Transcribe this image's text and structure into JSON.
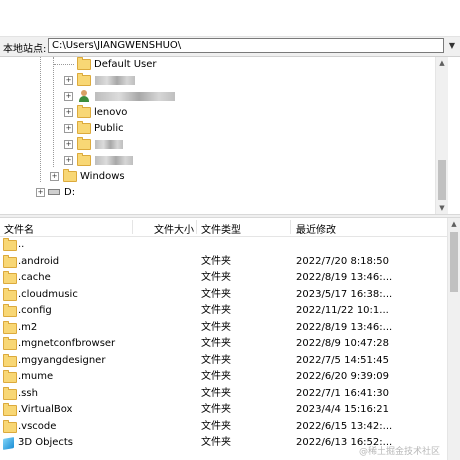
{
  "path_bar": {
    "label": "本地站点:",
    "value": "C:\\Users\\JIANGWENSHUO\\"
  },
  "tree": {
    "nodes": [
      {
        "label": "Default User",
        "expander": false,
        "icon": "folder-icon"
      },
      {
        "label": "",
        "expander": true,
        "icon": "folder-icon",
        "redacted": true
      },
      {
        "label": "",
        "expander": true,
        "icon": "user-folder-icon",
        "redacted": true
      },
      {
        "label": "lenovo",
        "expander": true,
        "icon": "folder-icon"
      },
      {
        "label": "Public",
        "expander": true,
        "icon": "folder-icon"
      },
      {
        "label": "",
        "expander": true,
        "icon": "folder-icon",
        "redacted": true
      },
      {
        "label": "",
        "expander": true,
        "icon": "folder-icon",
        "redacted": true
      },
      {
        "label": "Windows",
        "expander": true,
        "icon": "folder-icon"
      },
      {
        "label": "D:",
        "expander": true,
        "icon": "drive-icon"
      }
    ],
    "expander_symbol": "+"
  },
  "file_list": {
    "columns": {
      "name": "文件名",
      "size": "文件大小",
      "type": "文件类型",
      "modified": "最近修改"
    },
    "rows": [
      {
        "name": "..",
        "type": "",
        "modified": "",
        "icon": "folder-icon"
      },
      {
        "name": ".android",
        "type": "文件夹",
        "modified": "2022/7/20 8:18:50",
        "icon": "folder-icon"
      },
      {
        "name": ".cache",
        "type": "文件夹",
        "modified": "2022/8/19 13:46:...",
        "icon": "folder-icon"
      },
      {
        "name": ".cloudmusic",
        "type": "文件夹",
        "modified": "2023/5/17 16:38:...",
        "icon": "folder-icon"
      },
      {
        "name": ".config",
        "type": "文件夹",
        "modified": "2022/11/22 10:1...",
        "icon": "folder-icon"
      },
      {
        "name": ".m2",
        "type": "文件夹",
        "modified": "2022/8/19 13:46:...",
        "icon": "folder-icon"
      },
      {
        "name": ".mgnetconfbrowser",
        "type": "文件夹",
        "modified": "2022/8/9 10:47:28",
        "icon": "folder-icon"
      },
      {
        "name": ".mgyangdesigner",
        "type": "文件夹",
        "modified": "2022/7/5 14:51:45",
        "icon": "folder-icon"
      },
      {
        "name": ".mume",
        "type": "文件夹",
        "modified": "2022/6/20 9:39:09",
        "icon": "folder-icon"
      },
      {
        "name": ".ssh",
        "type": "文件夹",
        "modified": "2022/7/1 16:41:30",
        "icon": "folder-icon"
      },
      {
        "name": ".VirtualBox",
        "type": "文件夹",
        "modified": "2023/4/4 15:16:21",
        "icon": "folder-icon"
      },
      {
        "name": ".vscode",
        "type": "文件夹",
        "modified": "2022/6/15 13:42:...",
        "icon": "folder-icon"
      },
      {
        "name": "3D Objects",
        "type": "文件夹",
        "modified": "2022/6/13 16:52:...",
        "icon": "3d-objects-icon"
      }
    ]
  },
  "watermark": "@稀土掘金技术社区",
  "colors": {
    "folder": "#f8d775",
    "folder_border": "#dcaa3c",
    "chrome": "#f0f0f0"
  }
}
